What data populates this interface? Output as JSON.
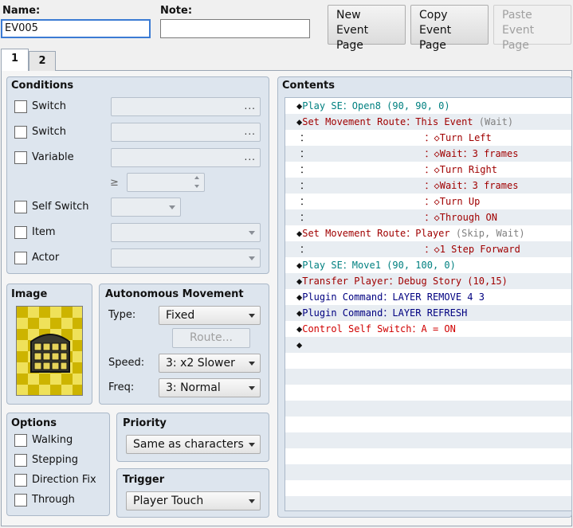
{
  "header": {
    "name_label": "Name:",
    "name_value": "EV005",
    "note_label": "Note:",
    "note_value": "",
    "new_button": [
      "New",
      "Event Page"
    ],
    "copy_button": [
      "Copy",
      "Event Page"
    ],
    "paste_button": [
      "Paste",
      "Event Page"
    ]
  },
  "tabs": [
    "1",
    "2"
  ],
  "conditions": {
    "title": "Conditions",
    "switch1": "Switch",
    "switch2": "Switch",
    "variable": "Variable",
    "dots": "...",
    "gte": "≥",
    "self_switch": "Self Switch",
    "item": "Item",
    "actor": "Actor"
  },
  "image": {
    "title": "Image"
  },
  "autonomous": {
    "title": "Autonomous Movement",
    "type_label": "Type:",
    "type_value": "Fixed",
    "route_button": "Route...",
    "speed_label": "Speed:",
    "speed_value": "3: x2 Slower",
    "freq_label": "Freq:",
    "freq_value": "3: Normal"
  },
  "options": {
    "title": "Options",
    "walking": "Walking",
    "stepping": "Stepping",
    "direction_fix": "Direction Fix",
    "through": "Through"
  },
  "priority": {
    "title": "Priority",
    "value": "Same as characters"
  },
  "trigger": {
    "title": "Trigger",
    "value": "Player Touch"
  },
  "contents": {
    "title": "Contents",
    "rows": [
      {
        "p": "◆",
        "a": "Play SE：Open8 (90, 90, 0)",
        "ac": "c-se",
        "b": "",
        "bc": ""
      },
      {
        "p": "◆",
        "a": "Set Movement Route：This Event",
        "ac": "c-route",
        "b": " (Wait)",
        "bc": "c-gray"
      },
      {
        "p": "：",
        "a": "                    ：◇Turn Left",
        "ac": "c-route",
        "b": "",
        "bc": ""
      },
      {
        "p": "：",
        "a": "                    ：◇Wait：3 frames",
        "ac": "c-route",
        "b": "",
        "bc": ""
      },
      {
        "p": "：",
        "a": "                    ：◇Turn Right",
        "ac": "c-route",
        "b": "",
        "bc": ""
      },
      {
        "p": "：",
        "a": "                    ：◇Wait：3 frames",
        "ac": "c-route",
        "b": "",
        "bc": ""
      },
      {
        "p": "：",
        "a": "                    ：◇Turn Up",
        "ac": "c-route",
        "b": "",
        "bc": ""
      },
      {
        "p": "：",
        "a": "                    ：◇Through ON",
        "ac": "c-route",
        "b": "",
        "bc": ""
      },
      {
        "p": "◆",
        "a": "Set Movement Route：Player",
        "ac": "c-route",
        "b": " (Skip, Wait)",
        "bc": "c-gray"
      },
      {
        "p": "：",
        "a": "                    ：◇1 Step Forward",
        "ac": "c-route",
        "b": "",
        "bc": ""
      },
      {
        "p": "◆",
        "a": "Play SE：Move1 (90, 100, 0)",
        "ac": "c-se",
        "b": "",
        "bc": ""
      },
      {
        "p": "◆",
        "a": "Transfer Player：Debug Story (10,15)",
        "ac": "c-route",
        "b": "",
        "bc": ""
      },
      {
        "p": "◆",
        "a": "Plugin Command：LAYER REMOVE 4 3",
        "ac": "c-plug",
        "b": "",
        "bc": ""
      },
      {
        "p": "◆",
        "a": "Plugin Command：LAYER REFRESH",
        "ac": "c-plug",
        "b": "",
        "bc": ""
      },
      {
        "p": "◆",
        "a": "Control Self Switch：A = ON",
        "ac": "c-red",
        "b": "",
        "bc": ""
      },
      {
        "p": "◆",
        "a": "",
        "ac": "",
        "b": "",
        "bc": ""
      }
    ]
  }
}
